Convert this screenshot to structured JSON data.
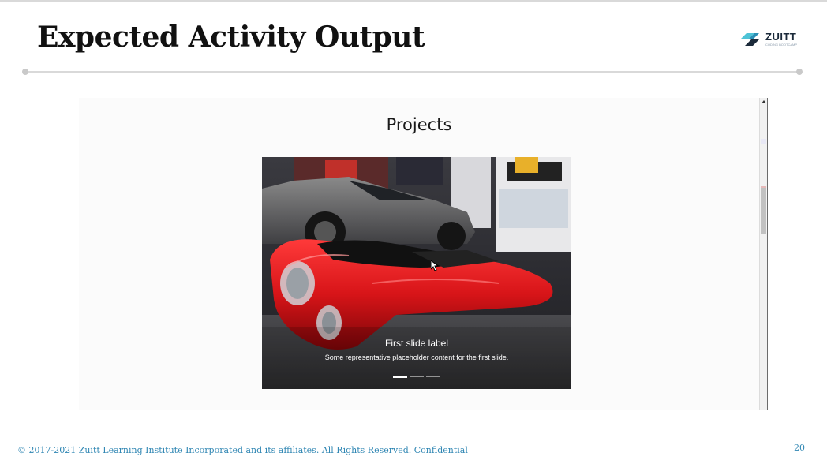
{
  "slide": {
    "title": "Expected Activity Output",
    "logo": {
      "text": "ZUITT",
      "sub": "CODING BOOTCAMP"
    },
    "footer": "© 2017-2021 Zuitt Learning Institute Incorporated and its affiliates. All Rights Reserved. Confidential",
    "page_number": "20"
  },
  "webpage": {
    "section_heading": "Projects",
    "carousel": {
      "active_index": 0,
      "slide_count": 3,
      "slides": [
        {
          "label": "First slide label",
          "text": "Some representative placeholder content for the first slide."
        }
      ],
      "image_subject": "red-vintage-roadster-car-show-photo"
    }
  },
  "colors": {
    "accent_blue": "#2f86b3",
    "logo_teal": "#4ec3d6",
    "logo_navy": "#1b2a3a",
    "car_red": "#d71418"
  }
}
